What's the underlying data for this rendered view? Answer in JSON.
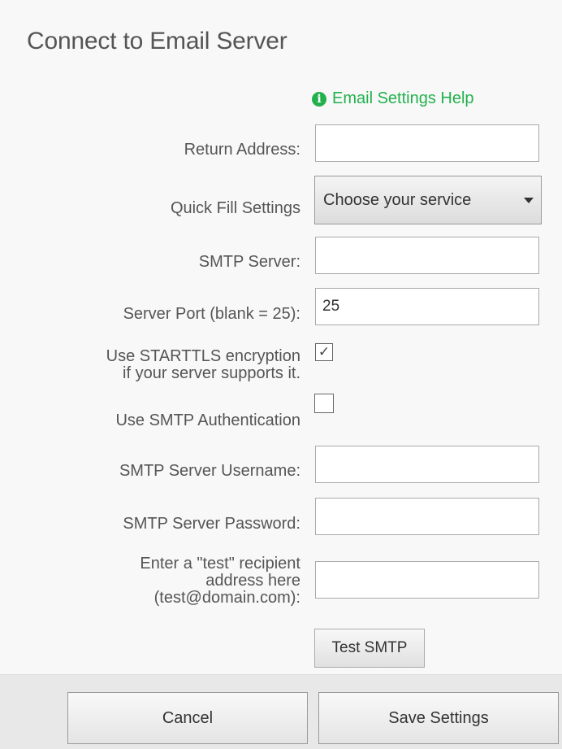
{
  "dialog": {
    "title": "Connect to Email Server",
    "help_link": "Email Settings Help",
    "help_icon": "info-icon",
    "accent_color": "#22b14c"
  },
  "fields": {
    "return_address": {
      "label": "Return Address:",
      "value": ""
    },
    "quick_fill": {
      "label": "Quick Fill Settings",
      "selected": "Choose your service"
    },
    "smtp_server": {
      "label": "SMTP Server:",
      "value": ""
    },
    "server_port": {
      "label": "Server Port (blank = 25):",
      "value": "25"
    },
    "starttls": {
      "label_line1": "Use STARTTLS encryption",
      "label_line2": "if your server supports it.",
      "checked": true,
      "check_glyph": "✓"
    },
    "smtp_auth": {
      "label": "Use SMTP Authentication",
      "checked": false
    },
    "username": {
      "label": "SMTP Server Username:",
      "value": ""
    },
    "password": {
      "label": "SMTP Server Password:",
      "value": ""
    },
    "test_recipient": {
      "label_line1": "Enter a \"test\" recipient",
      "label_line2": "address here",
      "label_line3": "(test@domain.com):",
      "value": ""
    }
  },
  "buttons": {
    "test_smtp": "Test SMTP",
    "cancel": "Cancel",
    "save": "Save Settings"
  }
}
